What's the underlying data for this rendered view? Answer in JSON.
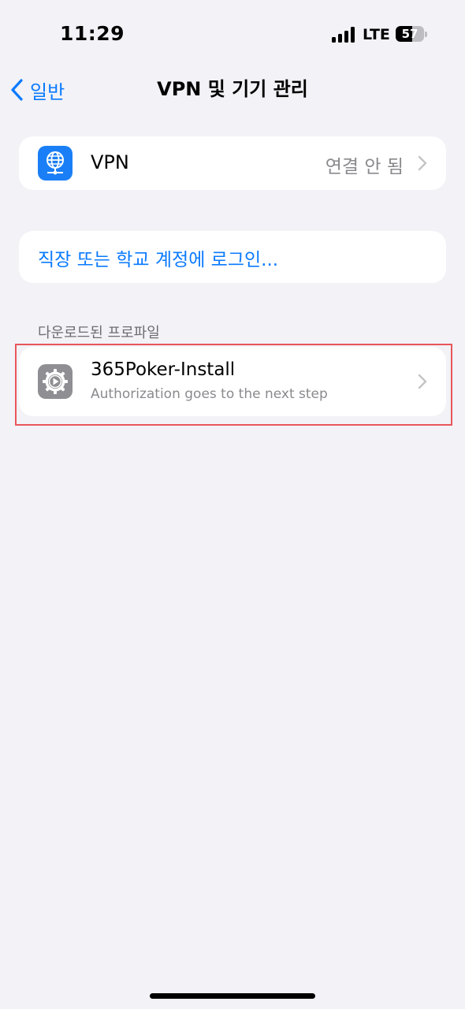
{
  "status_bar": {
    "time": "11:29",
    "network": "LTE",
    "battery_level": "57",
    "battery_fraction": 0.57,
    "signal_bars": 4
  },
  "nav": {
    "back_label": "일반",
    "title": "VPN 및 기기 관리"
  },
  "vpn_row": {
    "icon": "globe-network-icon",
    "label": "VPN",
    "status": "연결 안 됨"
  },
  "signin": {
    "label": "직장 또는 학교 계정에 로그인..."
  },
  "profiles_section": {
    "header": "다운로드된 프로파일",
    "items": [
      {
        "icon": "gear-icon",
        "name": "365Poker-Install",
        "subtitle": "Authorization goes to the next step"
      }
    ]
  },
  "colors": {
    "background": "#f2f2f7",
    "accent": "#0a7aff",
    "vpn_icon_bg": "#1a7ff6",
    "profile_icon_bg": "#8e8e93",
    "highlight": "#e8565a"
  }
}
